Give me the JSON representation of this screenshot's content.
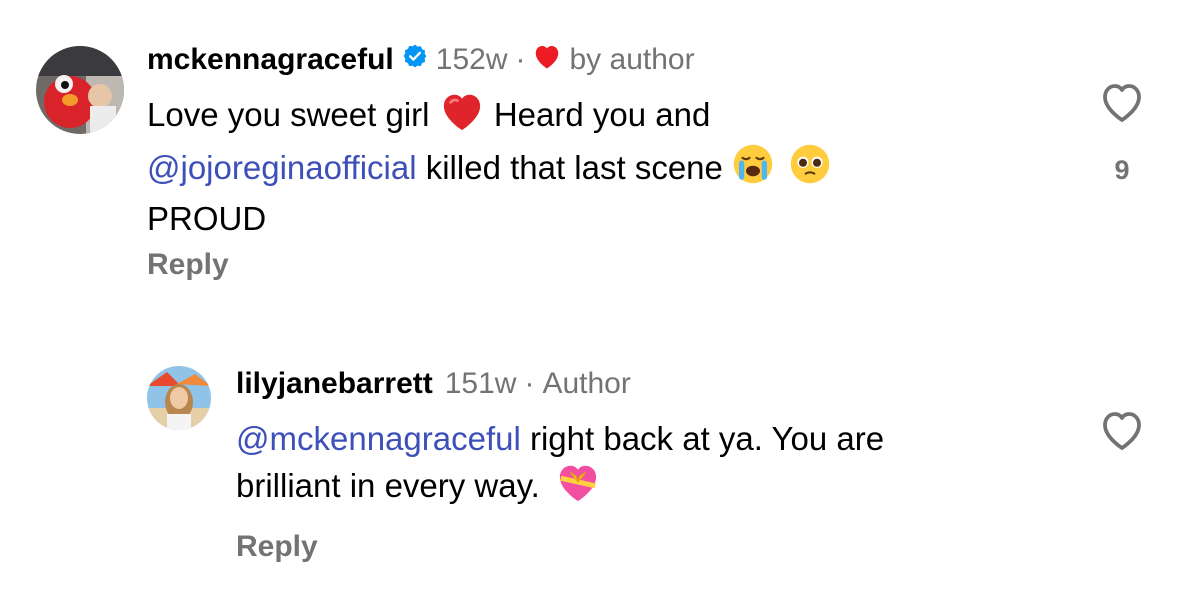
{
  "comment": {
    "username": "mckennagraceful",
    "age": "152w",
    "separator": "·",
    "liked_by_author_label": "by author",
    "text_part1": "Love you sweet girl",
    "text_part2": "Heard you and",
    "mention": "@jojoreginaofficial",
    "text_part3": "killed that last scene",
    "text_part4": "PROUD",
    "reply_label": "Reply",
    "like_count": "9"
  },
  "reply": {
    "username": "lilyjanebarrett",
    "age": "151w",
    "separator": "·",
    "author_badge": "Author",
    "mention": "@mckennagraceful",
    "text_part1": "right back at ya. You are",
    "text_part2": "brilliant in every way.",
    "reply_label": "Reply"
  },
  "colors": {
    "mention": "#3d4fb8",
    "meta_gray": "#737373",
    "verified_blue": "#0095f6",
    "heart_red": "#ed1c24"
  },
  "icons": {
    "verified": "verified-badge-icon",
    "author_heart": "heart-icon",
    "like": "heart-outline-icon",
    "emoji_heart": "red-heart-emoji",
    "emoji_cry": "loudly-crying-face-emoji",
    "emoji_plead": "pleading-face-emoji",
    "emoji_gift_heart": "heart-with-ribbon-emoji"
  }
}
